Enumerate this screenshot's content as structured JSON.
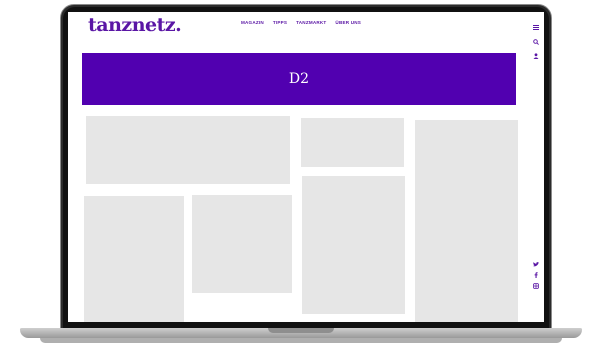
{
  "site": {
    "logo": "tanznetz.",
    "nav": [
      "MAGAZIN",
      "TIPPS",
      "TANZMARKT",
      "ÜBER UNS"
    ],
    "banner_text": "D2"
  },
  "icons": {
    "menu": "hamburger-menu-icon",
    "search": "search-icon",
    "user": "user-icon",
    "twitter": "twitter-icon",
    "facebook": "facebook-icon",
    "instagram": "instagram-icon"
  },
  "colors": {
    "brand": "#5a16a5",
    "banner": "#5100b0",
    "placeholder": "#e6e6e6"
  }
}
